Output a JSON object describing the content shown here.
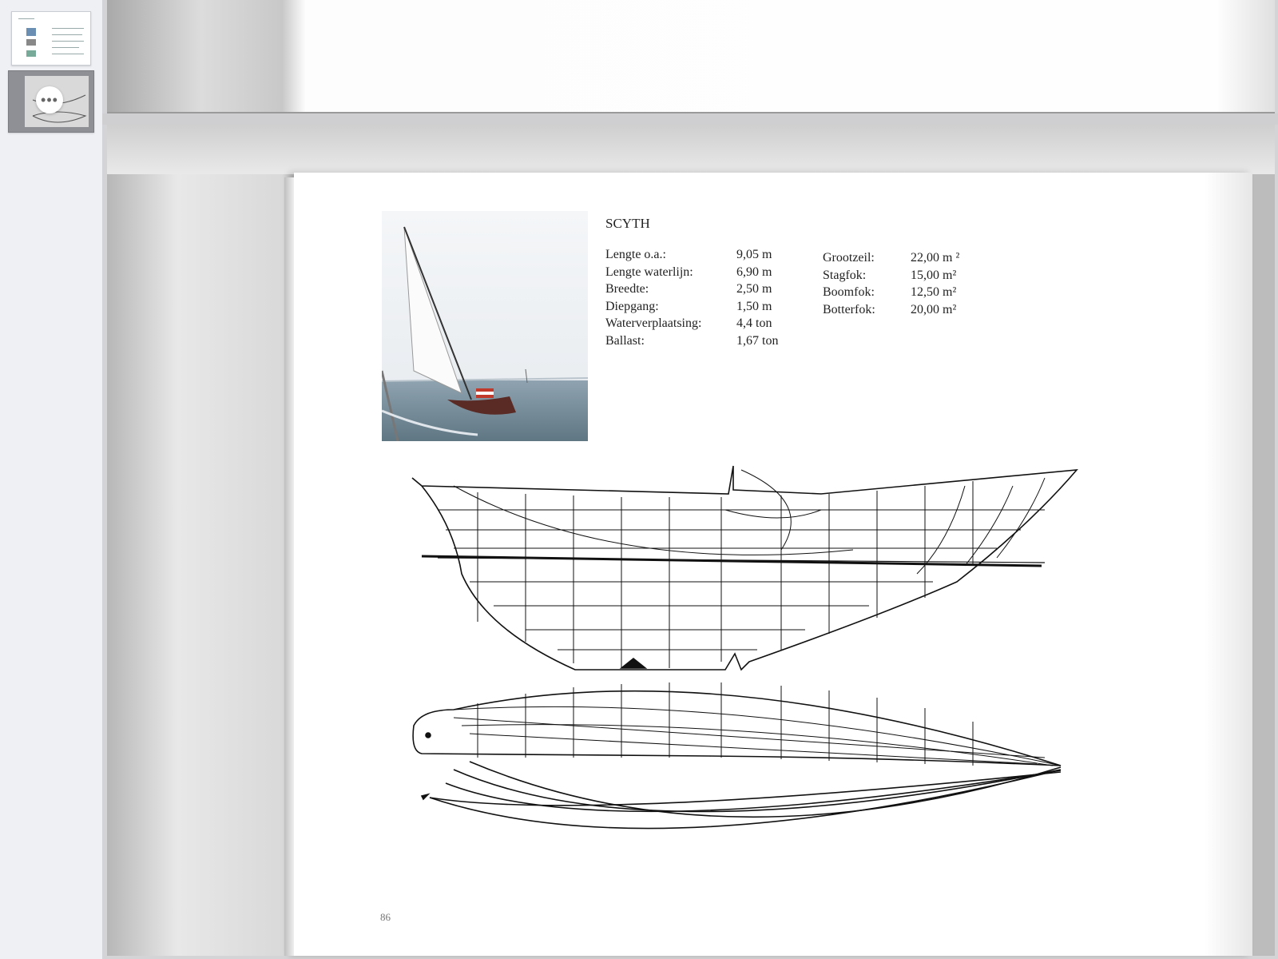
{
  "sidebar": {
    "pages": [
      {
        "label": "page-1-thumbnail"
      },
      {
        "label": "page-2-thumbnail"
      }
    ],
    "more_button": "•••"
  },
  "document": {
    "boat_name": "SCYTH",
    "specs": [
      {
        "label": "Lengte o.a.:",
        "value": "9,05 m"
      },
      {
        "label": "Lengte waterlijn:",
        "value": "6,90 m"
      },
      {
        "label": "Breedte:",
        "value": "2,50 m"
      },
      {
        "label": "Diepgang:",
        "value": "1,50 m"
      },
      {
        "label": "Waterverplaatsing:",
        "value": "4,4 ton"
      },
      {
        "label": "Ballast:",
        "value": "1,67 ton"
      }
    ],
    "sails": [
      {
        "label": "Grootzeil:",
        "value": "22,00 m ²"
      },
      {
        "label": "Stagfok:",
        "value": "15,00 m²"
      },
      {
        "label": "Boomfok:",
        "value": "12,50 m²"
      },
      {
        "label": "Botterfok:",
        "value": "20,00 m²"
      }
    ],
    "page_number": "86"
  },
  "colors": {
    "sidebar_bg": "#eef0f4",
    "viewer_bg": "#d4d4d6",
    "paper": "#ffffff"
  }
}
